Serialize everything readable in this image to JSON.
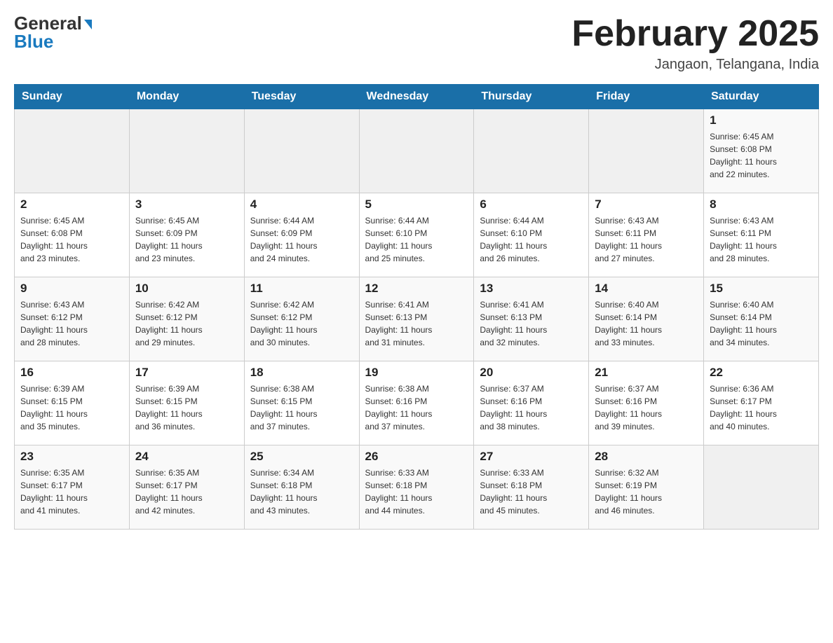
{
  "header": {
    "logo_general": "General",
    "logo_blue": "Blue",
    "title": "February 2025",
    "subtitle": "Jangaon, Telangana, India"
  },
  "days_of_week": [
    "Sunday",
    "Monday",
    "Tuesday",
    "Wednesday",
    "Thursday",
    "Friday",
    "Saturday"
  ],
  "weeks": [
    [
      {
        "day": "",
        "info": ""
      },
      {
        "day": "",
        "info": ""
      },
      {
        "day": "",
        "info": ""
      },
      {
        "day": "",
        "info": ""
      },
      {
        "day": "",
        "info": ""
      },
      {
        "day": "",
        "info": ""
      },
      {
        "day": "1",
        "info": "Sunrise: 6:45 AM\nSunset: 6:08 PM\nDaylight: 11 hours\nand 22 minutes."
      }
    ],
    [
      {
        "day": "2",
        "info": "Sunrise: 6:45 AM\nSunset: 6:08 PM\nDaylight: 11 hours\nand 23 minutes."
      },
      {
        "day": "3",
        "info": "Sunrise: 6:45 AM\nSunset: 6:09 PM\nDaylight: 11 hours\nand 23 minutes."
      },
      {
        "day": "4",
        "info": "Sunrise: 6:44 AM\nSunset: 6:09 PM\nDaylight: 11 hours\nand 24 minutes."
      },
      {
        "day": "5",
        "info": "Sunrise: 6:44 AM\nSunset: 6:10 PM\nDaylight: 11 hours\nand 25 minutes."
      },
      {
        "day": "6",
        "info": "Sunrise: 6:44 AM\nSunset: 6:10 PM\nDaylight: 11 hours\nand 26 minutes."
      },
      {
        "day": "7",
        "info": "Sunrise: 6:43 AM\nSunset: 6:11 PM\nDaylight: 11 hours\nand 27 minutes."
      },
      {
        "day": "8",
        "info": "Sunrise: 6:43 AM\nSunset: 6:11 PM\nDaylight: 11 hours\nand 28 minutes."
      }
    ],
    [
      {
        "day": "9",
        "info": "Sunrise: 6:43 AM\nSunset: 6:12 PM\nDaylight: 11 hours\nand 28 minutes."
      },
      {
        "day": "10",
        "info": "Sunrise: 6:42 AM\nSunset: 6:12 PM\nDaylight: 11 hours\nand 29 minutes."
      },
      {
        "day": "11",
        "info": "Sunrise: 6:42 AM\nSunset: 6:12 PM\nDaylight: 11 hours\nand 30 minutes."
      },
      {
        "day": "12",
        "info": "Sunrise: 6:41 AM\nSunset: 6:13 PM\nDaylight: 11 hours\nand 31 minutes."
      },
      {
        "day": "13",
        "info": "Sunrise: 6:41 AM\nSunset: 6:13 PM\nDaylight: 11 hours\nand 32 minutes."
      },
      {
        "day": "14",
        "info": "Sunrise: 6:40 AM\nSunset: 6:14 PM\nDaylight: 11 hours\nand 33 minutes."
      },
      {
        "day": "15",
        "info": "Sunrise: 6:40 AM\nSunset: 6:14 PM\nDaylight: 11 hours\nand 34 minutes."
      }
    ],
    [
      {
        "day": "16",
        "info": "Sunrise: 6:39 AM\nSunset: 6:15 PM\nDaylight: 11 hours\nand 35 minutes."
      },
      {
        "day": "17",
        "info": "Sunrise: 6:39 AM\nSunset: 6:15 PM\nDaylight: 11 hours\nand 36 minutes."
      },
      {
        "day": "18",
        "info": "Sunrise: 6:38 AM\nSunset: 6:15 PM\nDaylight: 11 hours\nand 37 minutes."
      },
      {
        "day": "19",
        "info": "Sunrise: 6:38 AM\nSunset: 6:16 PM\nDaylight: 11 hours\nand 37 minutes."
      },
      {
        "day": "20",
        "info": "Sunrise: 6:37 AM\nSunset: 6:16 PM\nDaylight: 11 hours\nand 38 minutes."
      },
      {
        "day": "21",
        "info": "Sunrise: 6:37 AM\nSunset: 6:16 PM\nDaylight: 11 hours\nand 39 minutes."
      },
      {
        "day": "22",
        "info": "Sunrise: 6:36 AM\nSunset: 6:17 PM\nDaylight: 11 hours\nand 40 minutes."
      }
    ],
    [
      {
        "day": "23",
        "info": "Sunrise: 6:35 AM\nSunset: 6:17 PM\nDaylight: 11 hours\nand 41 minutes."
      },
      {
        "day": "24",
        "info": "Sunrise: 6:35 AM\nSunset: 6:17 PM\nDaylight: 11 hours\nand 42 minutes."
      },
      {
        "day": "25",
        "info": "Sunrise: 6:34 AM\nSunset: 6:18 PM\nDaylight: 11 hours\nand 43 minutes."
      },
      {
        "day": "26",
        "info": "Sunrise: 6:33 AM\nSunset: 6:18 PM\nDaylight: 11 hours\nand 44 minutes."
      },
      {
        "day": "27",
        "info": "Sunrise: 6:33 AM\nSunset: 6:18 PM\nDaylight: 11 hours\nand 45 minutes."
      },
      {
        "day": "28",
        "info": "Sunrise: 6:32 AM\nSunset: 6:19 PM\nDaylight: 11 hours\nand 46 minutes."
      },
      {
        "day": "",
        "info": ""
      }
    ]
  ]
}
